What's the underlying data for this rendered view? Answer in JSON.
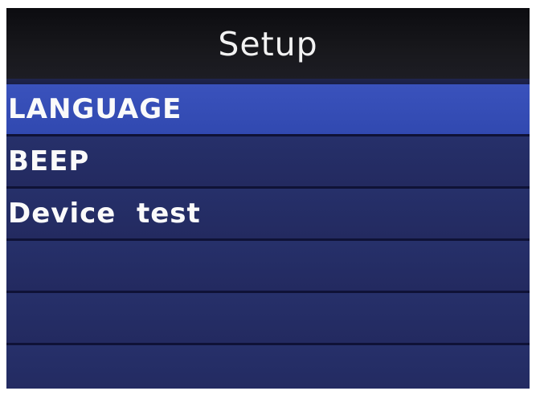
{
  "screen": {
    "title": "Setup"
  },
  "menu": {
    "selected_index": 0,
    "items": [
      {
        "label": "LANGUAGE"
      },
      {
        "label": "BEEP"
      },
      {
        "label": "Device  test"
      },
      {
        "label": ""
      },
      {
        "label": ""
      },
      {
        "label": ""
      }
    ]
  },
  "colors": {
    "title_bar": "#17171b",
    "menu_background": "#232a60",
    "selected_highlight": "#3149b0",
    "divider": "#0f1236",
    "text": "#fafafa"
  }
}
